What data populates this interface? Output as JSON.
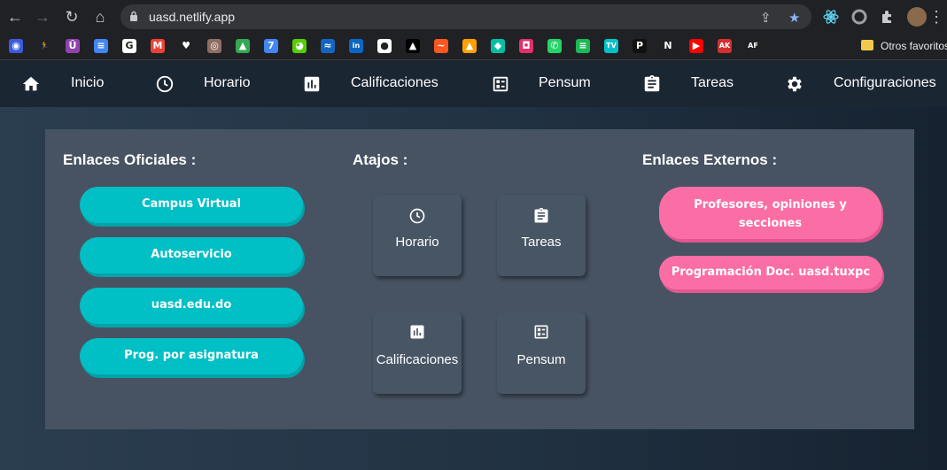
{
  "browser": {
    "url": "uasd.netlify.app",
    "bookmarks_folder": "Otros favoritos",
    "bookmarks": [
      {
        "label": "",
        "icon": "shield-icon",
        "color": "#3b5bdb",
        "glyph": "◉"
      },
      {
        "label": "",
        "icon": "runner-icon",
        "color": "#202124",
        "glyph": "🏃"
      },
      {
        "label": "",
        "icon": "u-logo-icon",
        "color": "#8e44ad",
        "glyph": "Û"
      },
      {
        "label": "",
        "icon": "docs-icon",
        "color": "#4285f4",
        "glyph": "≡"
      },
      {
        "label": "",
        "icon": "google-icon",
        "color": "#ffffff",
        "glyph": "G"
      },
      {
        "label": "",
        "icon": "gmail-icon",
        "color": "#ea4335",
        "glyph": "M"
      },
      {
        "label": "",
        "icon": "heart-icon",
        "color": "#202124",
        "glyph": "♥"
      },
      {
        "label": "",
        "icon": "owl-icon",
        "color": "#8d6e63",
        "glyph": "◎"
      },
      {
        "label": "",
        "icon": "drive-icon",
        "color": "#34a853",
        "glyph": "▲"
      },
      {
        "label": "",
        "icon": "calendar-icon",
        "color": "#4285f4",
        "glyph": "7"
      },
      {
        "label": "",
        "icon": "duolingo-icon",
        "color": "#58cc02",
        "glyph": "◕"
      },
      {
        "label": "",
        "icon": "wave-icon",
        "color": "#1565c0",
        "glyph": "≈"
      },
      {
        "label": "",
        "icon": "linkedin-icon",
        "color": "#0a66c2",
        "glyph": "in"
      },
      {
        "label": "",
        "icon": "github-icon",
        "color": "#ffffff",
        "glyph": "●"
      },
      {
        "label": "",
        "icon": "vercel-icon",
        "color": "#000000",
        "glyph": "▲"
      },
      {
        "label": "",
        "icon": "activity-icon",
        "color": "#ff5722",
        "glyph": "~"
      },
      {
        "label": "",
        "icon": "firebase-icon",
        "color": "#ffa000",
        "glyph": "▲"
      },
      {
        "label": "",
        "icon": "diamond-icon",
        "color": "#00bfa5",
        "glyph": "◆"
      },
      {
        "label": "",
        "icon": "instagram-icon",
        "color": "#e1306c",
        "glyph": "◘"
      },
      {
        "label": "",
        "icon": "whatsapp-icon",
        "color": "#25d366",
        "glyph": "✆"
      },
      {
        "label": "",
        "icon": "spotify-icon",
        "color": "#1db954",
        "glyph": "≡"
      },
      {
        "label": "",
        "icon": "tv-icon",
        "color": "#00c2c7",
        "glyph": "TV"
      },
      {
        "label": "",
        "icon": "p-logo-icon",
        "color": "#111111",
        "glyph": "P"
      },
      {
        "label": "",
        "icon": "netflix-icon",
        "color": "#202124",
        "glyph": "N"
      },
      {
        "label": "",
        "icon": "youtube-icon",
        "color": "#ff0000",
        "glyph": "▶"
      },
      {
        "label": "",
        "icon": "ak-logo-icon",
        "color": "#d32f2f",
        "glyph": "AK"
      },
      {
        "label": "",
        "icon": "af-logo-icon",
        "color": "#202124",
        "glyph": "AF"
      }
    ]
  },
  "nav": {
    "items": [
      {
        "label": "Inicio",
        "icon": "home-icon"
      },
      {
        "label": "Horario",
        "icon": "clock-icon"
      },
      {
        "label": "Calificaciones",
        "icon": "bar-chart-icon"
      },
      {
        "label": "Pensum",
        "icon": "checklist-icon"
      },
      {
        "label": "Tareas",
        "icon": "clipboard-icon"
      },
      {
        "label": "Configuraciones",
        "icon": "gear-icon"
      }
    ]
  },
  "official": {
    "title": "Enlaces Oficiales :",
    "links": [
      "Campus Virtual",
      "Autoservicio",
      "uasd.edu.do",
      "Prog. por asignatura"
    ]
  },
  "shortcuts": {
    "title": "Atajos :",
    "cards": [
      {
        "label": "Horario",
        "icon": "clock-icon"
      },
      {
        "label": "Tareas",
        "icon": "clipboard-icon"
      },
      {
        "label": "Calificaciones",
        "icon": "bar-chart-icon"
      },
      {
        "label": "Pensum",
        "icon": "checklist-icon"
      }
    ]
  },
  "external": {
    "title": "Enlaces Externos :",
    "links": [
      "Profesores, opiniones y secciones",
      "Programación Doc. uasd.tuxpc"
    ]
  },
  "colors": {
    "teal": "#00bfc5",
    "pink": "#fb6ea5",
    "panel": "#475362",
    "nav": "#1b2633"
  }
}
